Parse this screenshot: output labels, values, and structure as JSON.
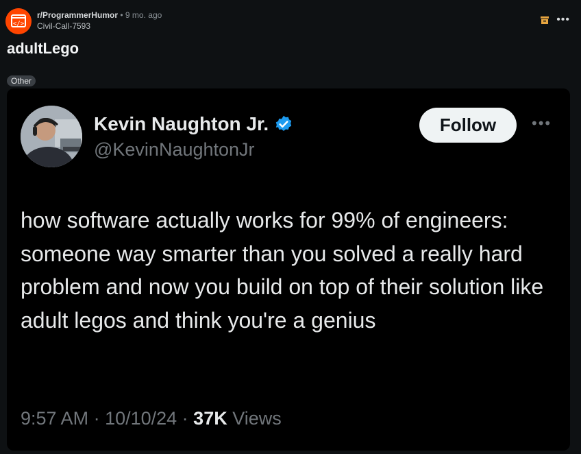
{
  "post": {
    "subreddit": "r/ProgrammerHumor",
    "separator": "•",
    "time": "9 mo. ago",
    "author": "Civil-Call-7593",
    "title": "adultLego",
    "flair": "Other",
    "icons": [
      "subreddit-avatar-icon",
      "archive-icon",
      "more-options-icon"
    ]
  },
  "tweet": {
    "name": "Kevin Naughton Jr.",
    "handle": "@KevinNaughtonJr",
    "follow_label": "Follow",
    "more_label": "•••",
    "text": "how software actually works for 99% of engineers: someone way smarter than you solved a really hard problem and now you build on top of their solution like adult legos and think you're a genius",
    "time": "9:57 AM",
    "sep": " · ",
    "date": "10/10/24",
    "views_count": "37K",
    "views_label": " Views",
    "verified_color": "#1d9bf0"
  }
}
